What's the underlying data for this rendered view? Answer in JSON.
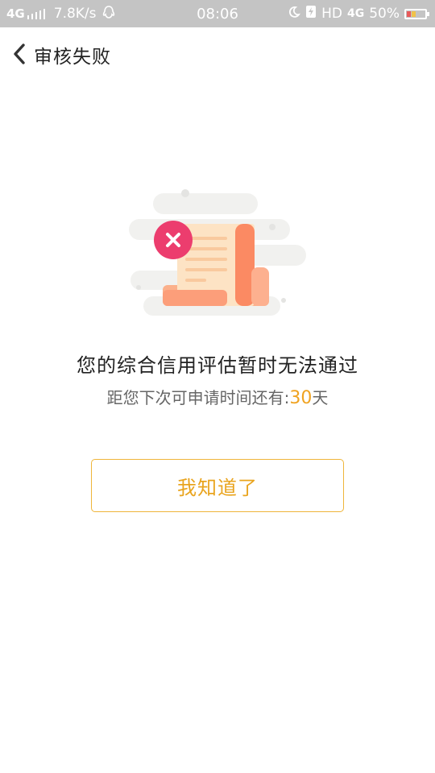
{
  "status_bar": {
    "network": "4G",
    "speed": "7.8K/s",
    "time": "08:06",
    "hd": "HD",
    "net_type": "4G",
    "battery": "50%"
  },
  "header": {
    "title": "审核失败"
  },
  "main": {
    "message": "您的综合信用评估暂时无法通过",
    "sub_prefix": "距您下次可申请时间还有:",
    "days": "30",
    "sub_suffix": "天",
    "confirm_label": "我知道了"
  },
  "colors": {
    "accent": "#efb53a",
    "days": "#f0a321",
    "status_bar": "#c4c4c4",
    "error_badge": "#e8336a"
  },
  "icons": {
    "back": "chevron-left-icon",
    "illustration": "failed-document-illustration"
  }
}
